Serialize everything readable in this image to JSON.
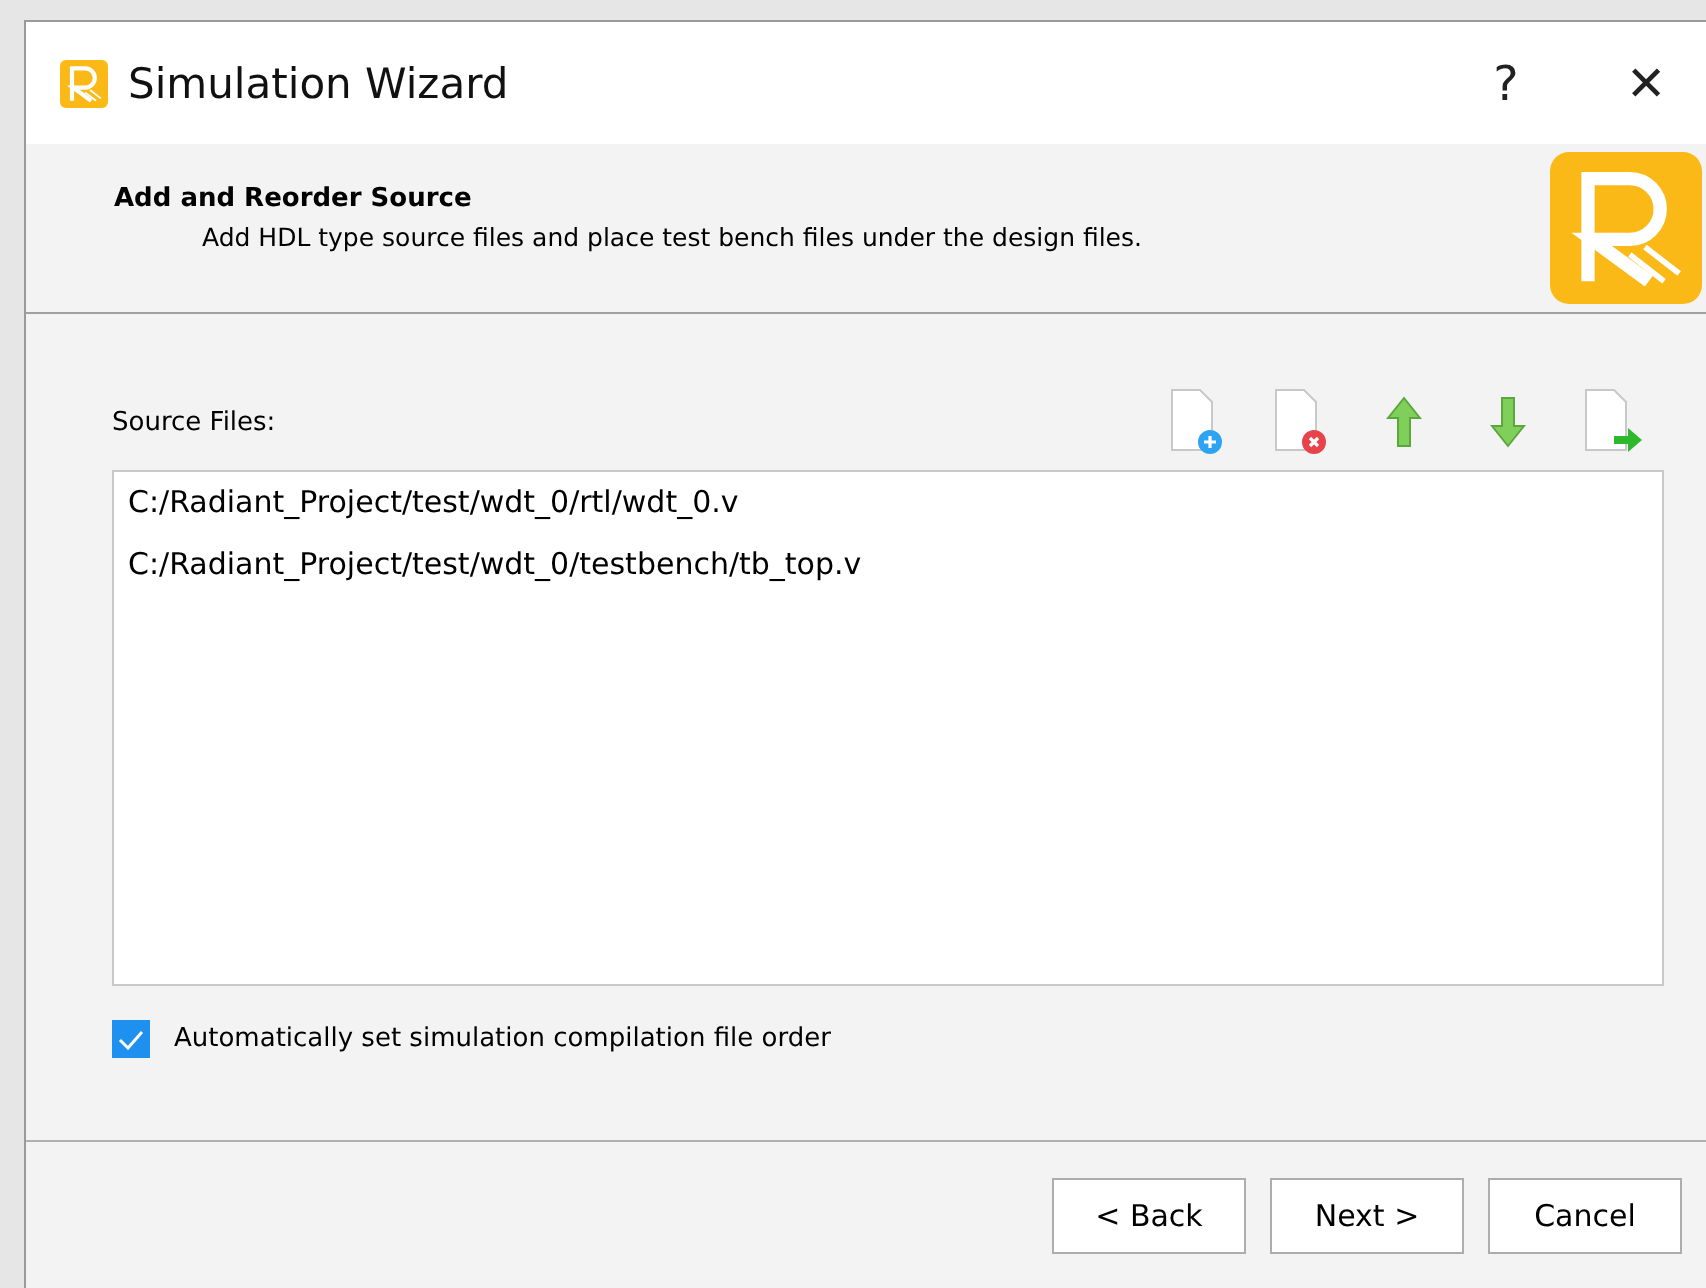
{
  "window": {
    "title": "Simulation Wizard",
    "help": "?",
    "close": "✕"
  },
  "header": {
    "title": "Add and Reorder Source",
    "subtitle": "Add HDL type source files and place test bench files under the design files."
  },
  "source_files": {
    "label": "Source Files:",
    "files": [
      {
        "path": "C:/Radiant_Project/test/wdt_0/rtl/wdt_0.v",
        "selected": false
      },
      {
        "path": "C:/Radiant_Project/test/wdt_0/testbench/tb_top.v",
        "selected": false
      }
    ]
  },
  "toolbar": [
    {
      "kind": "add"
    },
    {
      "kind": "remove"
    },
    {
      "kind": "up"
    },
    {
      "kind": "down"
    },
    {
      "kind": "export"
    }
  ],
  "auto_order": {
    "label": "Automatically set simulation compilation file order",
    "checked": true
  },
  "buttons": [
    "< Back",
    "Next >",
    "Cancel"
  ]
}
